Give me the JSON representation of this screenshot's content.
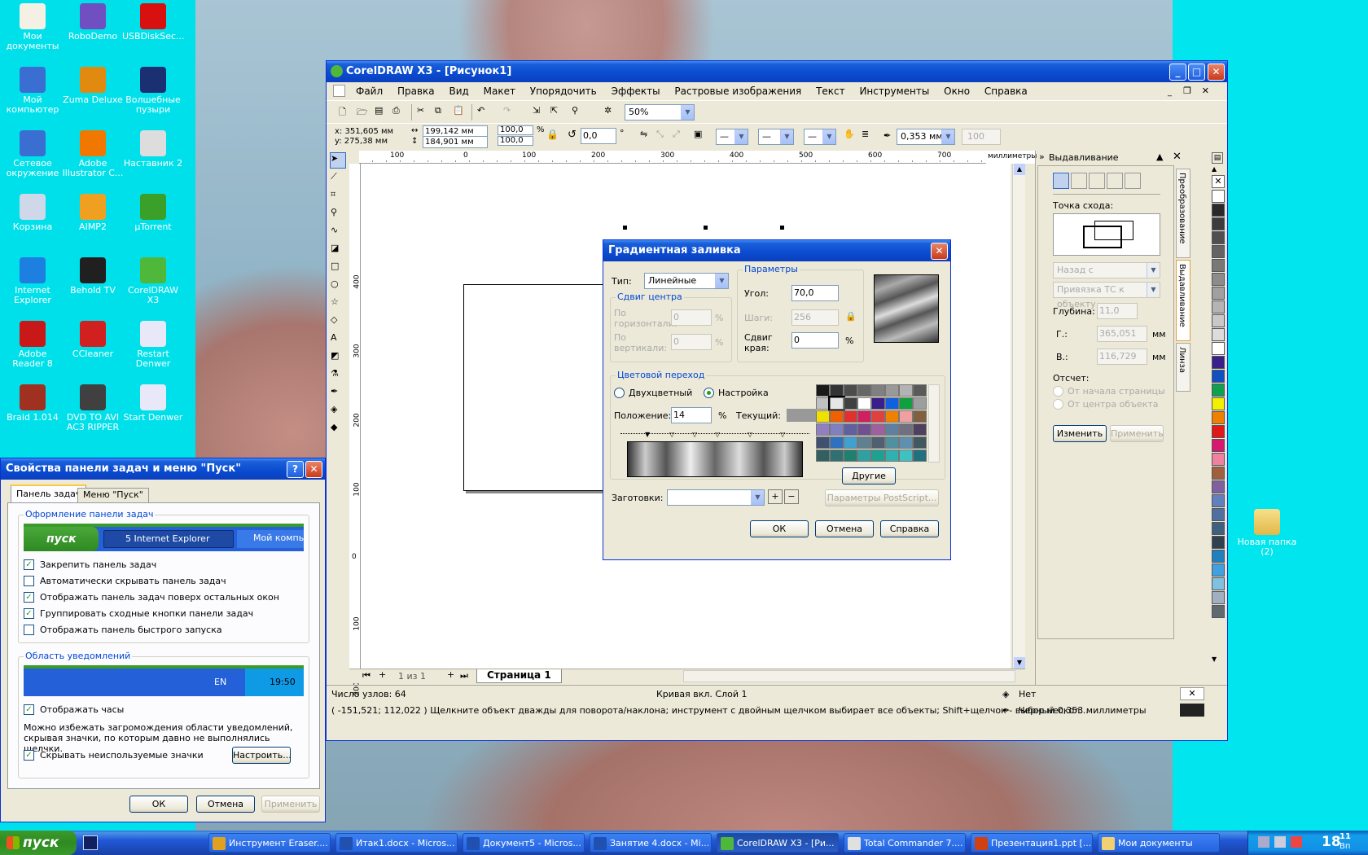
{
  "desktop": {
    "icons": [
      {
        "label": "Мои документы",
        "color": "#f4f1e4"
      },
      {
        "label": "RoboDemo",
        "color": "#7050c0"
      },
      {
        "label": "USBDiskSec...",
        "color": "#d81010"
      },
      {
        "label": "Мой компьютер",
        "color": "#3a6ed0"
      },
      {
        "label": "Zuma Deluxe",
        "color": "#e08a10"
      },
      {
        "label": "Волшебные пузыри",
        "color": "#1a3070"
      },
      {
        "label": "Сетевое окружение",
        "color": "#3a6ed0"
      },
      {
        "label": "Adobe Illustrator C...",
        "color": "#f07800"
      },
      {
        "label": "Наставник 2",
        "color": "#dddddd"
      },
      {
        "label": "Корзина",
        "color": "#cfd8e8"
      },
      {
        "label": "AIMP2",
        "color": "#f0a020"
      },
      {
        "label": "µTorrent",
        "color": "#3aa02a"
      },
      {
        "label": "Internet Explorer",
        "color": "#1d7fe0"
      },
      {
        "label": "Behold TV",
        "color": "#202020"
      },
      {
        "label": "CorelDRAW X3",
        "color": "#4fb83a"
      },
      {
        "label": "Adobe Reader 8",
        "color": "#c81818"
      },
      {
        "label": "CCleaner",
        "color": "#d02020"
      },
      {
        "label": "Restart Denwer",
        "color": "#e8e8f8"
      },
      {
        "label": "Braid 1.014",
        "color": "#a03020"
      },
      {
        "label": "DVD TO AVI AC3 RIPPER",
        "color": "#404040"
      },
      {
        "label": "Start Denwer",
        "color": "#e8e8f8"
      }
    ],
    "right_icon": {
      "label": "Новая папка (2)"
    }
  },
  "corel": {
    "title": "CorelDRAW X3 - [Рисунок1]",
    "menu": [
      "Файл",
      "Правка",
      "Вид",
      "Макет",
      "Упорядочить",
      "Эффекты",
      "Растровые изображения",
      "Текст",
      "Инструменты",
      "Окно",
      "Справка"
    ],
    "zoom": "50%",
    "prop": {
      "x": "x: 351,605 мм",
      "y": "y: 275,38 мм",
      "w": "199,142 мм",
      "h": "184,901 мм",
      "sx": "100,0",
      "sy": "100,0",
      "pct": "%",
      "angle": "0,0",
      "deg": "°",
      "outline": "0,353 мм",
      "dim": "100"
    },
    "ruler_top": [
      "100",
      "0",
      "100",
      "200",
      "300",
      "400",
      "500",
      "600",
      "700"
    ],
    "ruler_unit": "миллиметры",
    "ruler_left": [
      "400",
      "300",
      "200",
      "100",
      "0",
      "100",
      "200"
    ],
    "page_nav": {
      "count": "1 из 1",
      "tab": "Страница 1"
    },
    "status": {
      "nodes": "Число узлов: 64",
      "layer": "Кривая вкл. Слой 1",
      "hint": "( -151,521; 112,022 )  Щелкните объект дважды для поворота/наклона; инструмент с двойным щелчком выбирает все объекты; Shift+щелчок - выбор нескол...",
      "fill": "Нет",
      "outline": "Черный  0,353 миллиметры"
    },
    "docker": {
      "title": "Выдавливание",
      "vanish_label": "Точка схода:",
      "combo1": "Назад с уменьшением",
      "combo2": "Привязка ТС к объекту",
      "depth_label": "Глубина:",
      "depth": "11,0",
      "h_label": "Г.:",
      "h_val": "365,051",
      "v_label": "В.:",
      "v_val": "116,729",
      "unit": "мм",
      "offset_label": "Отсчет:",
      "opt1": "От начала страницы",
      "opt2": "От центра объекта",
      "btn_change": "Изменить",
      "btn_apply": "Применить",
      "tabs": [
        "Преобразование",
        "Выдавливание",
        "Линза"
      ]
    },
    "palette": [
      "#ffffff",
      "#2a2a2a",
      "#3c3c3c",
      "#505050",
      "#646464",
      "#787878",
      "#8c8c8c",
      "#a0a0a0",
      "#b4b4b4",
      "#c8c8c8",
      "#dcdcdc",
      "#ffffff",
      "#3a1e8c",
      "#1050c0",
      "#10a050",
      "#f0f000",
      "#f08000",
      "#e01818",
      "#d81870",
      "#f080a0",
      "#a06040",
      "#8060a0",
      "#6080c0",
      "#5070a0",
      "#406080",
      "#304050",
      "#2080c0",
      "#40a0e0",
      "#80c0e0",
      "#a0b0c0",
      "#606870"
    ]
  },
  "gradient": {
    "title": "Градиентная заливка",
    "type_label": "Тип:",
    "type_value": "Линейные",
    "center_group": "Сдвиг центра",
    "horiz_label": "По горизонтали:",
    "horiz_val": "0",
    "vert_label": "По вертикали:",
    "vert_val": "0",
    "pct": "%",
    "params_group": "Параметры",
    "angle_label": "Угол:",
    "angle_val": "70,0",
    "steps_label": "Шаги:",
    "steps_val": "256",
    "edge_label": "Сдвиг края:",
    "edge_val": "0",
    "blend_group": "Цветовой переход",
    "two_color": "Двухцветный",
    "custom": "Настройка",
    "position_label": "Положение:",
    "position_val": "14",
    "current_label": "Текущий:",
    "others_btn": "Другие",
    "presets_label": "Заготовки:",
    "postscript_btn": "Параметры PostScript...",
    "ok": "ОК",
    "cancel": "Отмена",
    "help": "Справка",
    "swatches": [
      "#1a1a1a",
      "#333333",
      "#4d4d4d",
      "#666666",
      "#808080",
      "#999999",
      "#b3b3b3",
      "#5a5a5a",
      "#c0c0c0",
      "#e6e6e6",
      "#404040",
      "#ffffff",
      "#3a1e8c",
      "#1060e0",
      "#10a040",
      "#9aa0a0",
      "#f0e000",
      "#f06000",
      "#e03030",
      "#d02060",
      "#e04040",
      "#f08000",
      "#f0a0a0",
      "#806040",
      "#9080c0",
      "#8080c0",
      "#6060a0",
      "#705090",
      "#a060a0",
      "#6080a0",
      "#707080",
      "#504060",
      "#405070",
      "#3070c0",
      "#40a0d0",
      "#608090",
      "#506070",
      "#5090a0",
      "#6090b0",
      "#405860",
      "#306060",
      "#307070",
      "#208070",
      "#30a0a0",
      "#20a090",
      "#30b0b0",
      "#40c0c0",
      "#207080"
    ]
  },
  "taskbar_props": {
    "title": "Свойства панели задач и меню \"Пуск\"",
    "tab1": "Панель задач",
    "tab2": "Меню \"Пуск\"",
    "group1": "Оформление панели задач",
    "preview_start": "пуск",
    "preview_task": "5 Internet Explorer",
    "preview_task2": "Мой компь",
    "checks": [
      {
        "label": "Закрепить панель задач",
        "on": true
      },
      {
        "label": "Автоматически скрывать панель задач",
        "on": false
      },
      {
        "label": "Отображать панель задач поверх остальных окон",
        "on": true
      },
      {
        "label": "Группировать сходные кнопки панели задач",
        "on": true
      },
      {
        "label": "Отображать панель быстрого запуска",
        "on": false
      }
    ],
    "group2": "Область уведомлений",
    "tray_lang": "EN",
    "tray_time": "19:50",
    "clock_check": "Отображать часы",
    "note": "Можно избежать загромождения области уведомлений, скрывая значки, по которым давно не выполнялись щелчки.",
    "hide_check": "Скрывать неиспользуемые значки",
    "customize_btn": "Настроить...",
    "ok": "ОК",
    "cancel": "Отмена",
    "apply": "Применить"
  },
  "taskbar": {
    "start": "пуск",
    "items": [
      {
        "label": "Инструмент Eraser....",
        "color": "#e0a020"
      },
      {
        "label": "Итак1.docx - Micros...",
        "color": "#2050b0"
      },
      {
        "label": "Документ5 - Micros...",
        "color": "#2050b0"
      },
      {
        "label": "Занятие 4.docx - Mi...",
        "color": "#2050b0"
      },
      {
        "label": "CorelDRAW X3 - [Ри...",
        "color": "#4fb83a"
      },
      {
        "label": "Total Commander 7....",
        "color": "#e0e0e0"
      },
      {
        "label": "Презентация1.ppt [...",
        "color": "#d04010"
      },
      {
        "label": "Мои документы",
        "color": "#f0d070"
      }
    ],
    "clock": "18",
    "clock_min": "11",
    "clock_ampm": "Вп"
  }
}
